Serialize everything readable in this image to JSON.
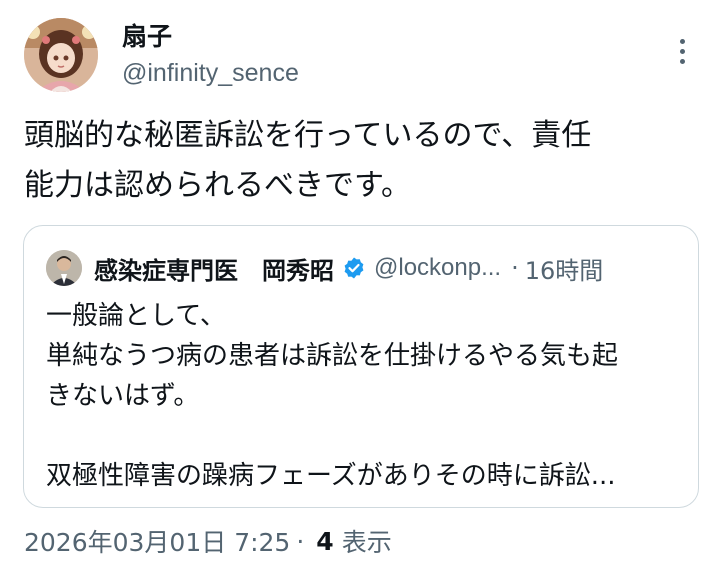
{
  "author": {
    "display_name": "扇子",
    "handle": "@infinity_sence"
  },
  "tweet": {
    "text": "頭脳的な秘匿訴訟を行っているので、責任\n能力は認められるべきです。"
  },
  "quoted": {
    "display_name": "感染症専門医　岡秀昭",
    "handle": "@lockonp...",
    "separator": "·",
    "time": "16時間",
    "text": "一般論として、\n単純なうつ病の患者は訴訟を仕掛けるやる気も起\nきないはず。\n\n双極性障害の躁病フェーズがありその時に訴訟..."
  },
  "meta": {
    "datetime": "2026年03月01日 7:25",
    "separator": "·",
    "views_count": "4",
    "views_label": "表示"
  },
  "colors": {
    "text_primary": "#0f1419",
    "text_secondary": "#536471",
    "border": "#cfd9de",
    "verified_blue": "#1d9bf0"
  }
}
